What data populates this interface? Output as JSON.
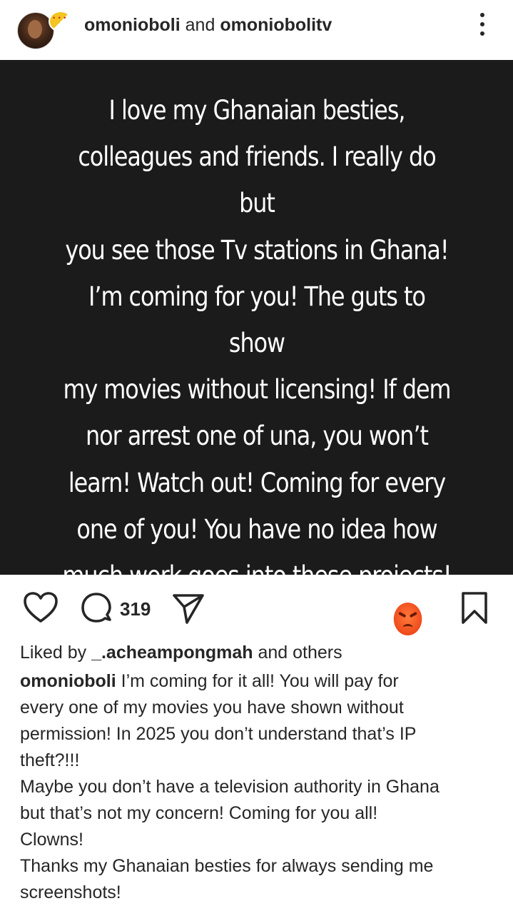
{
  "header": {
    "username": "omonioboli",
    "connector": "and",
    "collaborator": "omoniobolitv"
  },
  "post": {
    "text": "I love my Ghanaian besties,\ncolleagues and friends. I really do but\nyou see those Tv stations in Ghana!\nI’m coming for you! The guts to show\nmy movies without licensing! If dem\nnor arrest one of una, you won’t\nlearn! Watch out! Coming for every\none of you! You have no idea how\nmuch work goes into these projects!\nThe sleepless nights I have!",
    "emoji": "angry-face-icon",
    "background_color": "#1b1b1b"
  },
  "actions": {
    "comment_count": "319"
  },
  "likes": {
    "prefix": "Liked by",
    "user": "_.acheampongmah",
    "suffix": "and others"
  },
  "caption": {
    "username": "omonioboli",
    "text": "I’m coming for it all! You will pay for\nevery one of my movies you have shown without\npermission! In 2025 you don’t understand that’s IP\ntheft?!!!\nMaybe you don’t have a television authority in Ghana\nbut that’s not my concern! Coming for you all!\nClowns!\nThanks my Ghanaian besties for always sending me\nscreenshots!"
  }
}
